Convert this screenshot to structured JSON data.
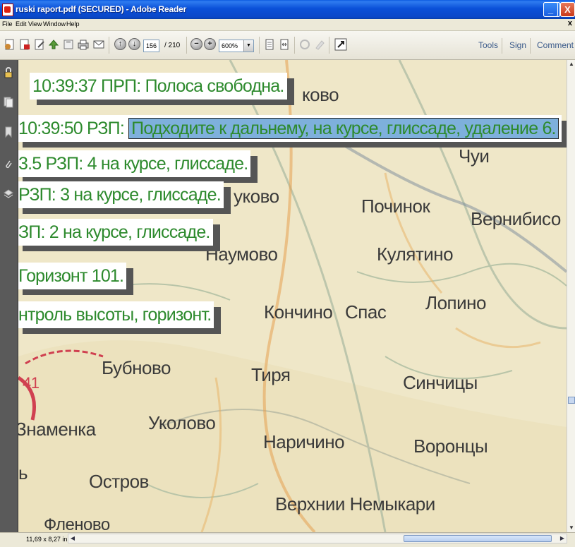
{
  "window": {
    "title": "ruski raport.pdf (SECURED) - Adobe Reader",
    "min_label": "_",
    "max_label": "□",
    "close_label": "X"
  },
  "menu": {
    "items": [
      "File",
      "Edit",
      "View",
      "Window",
      "Help"
    ],
    "close": "x"
  },
  "toolbar": {
    "page_current": "156",
    "page_total": "/ 210",
    "zoom": "600%",
    "tools_label": "Tools",
    "sign_label": "Sign",
    "comment_label": "Comment"
  },
  "document": {
    "transcript_lines": [
      "10:39:37 ПРП: Полоса свободна.",
      "10:39:50 РЗП:",
      "Подходите к дальнему, на курсе, глиссаде, удаление 6.",
      "3.5 РЗП: 4 на курсе, глиссаде.",
      "РЗП: 3 на курсе, глиссаде.",
      "ЗП: 2 на курсе, глиссаде.",
      "Горизонт 101.",
      "нтроль высоты, горизонт."
    ],
    "places": [
      "ково",
      "Чуи",
      "Почи",
      "Починок",
      "Вернибисо",
      "Наумово",
      "Кулятино",
      "Лопино",
      "Кончино",
      "Спас",
      "Бубново",
      "Тиря",
      "Синчицы",
      "Знаменка",
      "Уколово",
      "Наричино",
      "Воронцы",
      "Остров",
      "ь",
      "Верхнии Немыкари",
      "Фленово",
      "уково",
      "41"
    ]
  },
  "status": {
    "page_size": "11,69 x 8,27 in"
  },
  "colors": {
    "transcript_text": "#2d8a2d",
    "highlight": "#7eb0dc",
    "title_bar": "#0a50d8",
    "map_background": "#efe7c8"
  }
}
